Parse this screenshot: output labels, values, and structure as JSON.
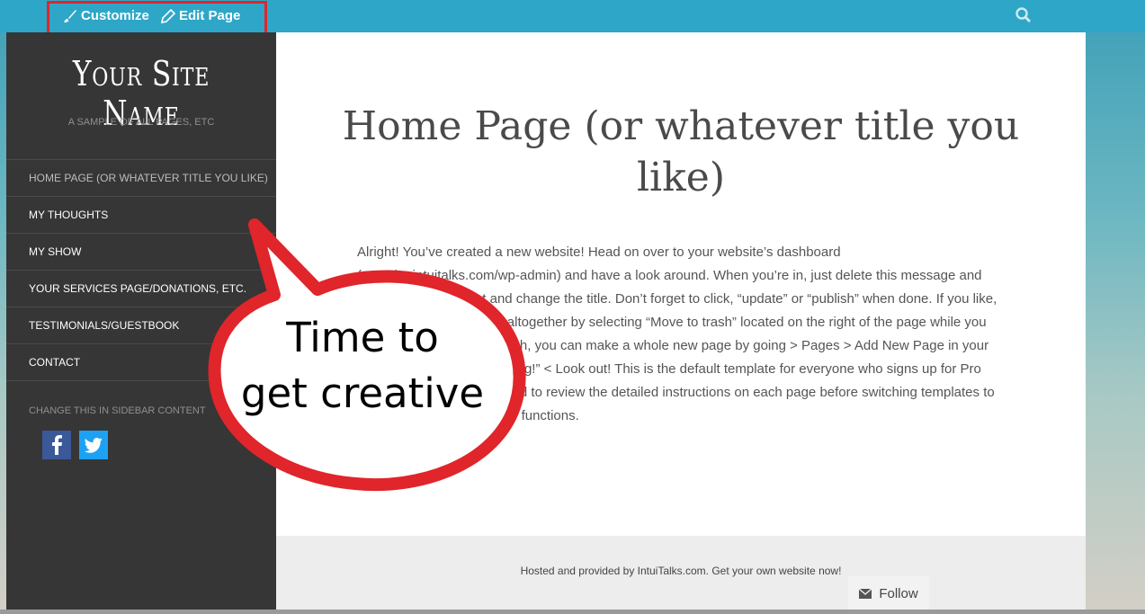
{
  "admin_bar": {
    "customize_label": "Customize",
    "edit_label": "Edit Page",
    "search_icon": "search-icon",
    "brush_icon": "brush-icon",
    "pencil_icon": "pencil-icon"
  },
  "sidebar": {
    "site_title": "Your Site Name",
    "site_description": "A SAMPLE OF ALL PAGES, ETC",
    "nav_items": [
      {
        "label": "HOME PAGE (OR WHATEVER TITLE YOU LIKE)"
      },
      {
        "label": "MY THOUGHTS"
      },
      {
        "label": "MY SHOW"
      },
      {
        "label": "YOUR SERVICES PAGE/DONATIONS, ETC."
      },
      {
        "label": "TESTIMONIALS/GUESTBOOK"
      },
      {
        "label": "CONTACT"
      }
    ],
    "widget_note": "CHANGE THIS IN SIDEBAR CONTENT",
    "social": [
      "facebook-icon",
      "twitter-icon"
    ]
  },
  "content": {
    "title": "Home Page (or whatever title you like)",
    "body": "Alright! You’ve created a new website! Head on over to your website’s dashboard (yoursite.intuitalks.com/wp-admin) and have a look around. When you’re in, just delete this message and add your own content and change the title. Don’t forget to click, “update” or “publish” when done. If you like, you can delete this page altogether by selecting “Move to trash” located on the right of the page while you are in edit mode. After which, you can make a whole new page by going > Pages > Add New Page in your dashboard. Happy “websiting!” < Look out! This is the default template for everyone who signs up for Pro Services. It is recommended to review the detailed instructions on each page before switching templates to get the most from all of our functions."
  },
  "footer": {
    "text": "Hosted and provided by IntuiTalks.com. Get your own website now!",
    "follow_label": "Follow"
  },
  "callout": {
    "line1": "Time to",
    "line2": "get creative",
    "color": "#e0252b"
  }
}
